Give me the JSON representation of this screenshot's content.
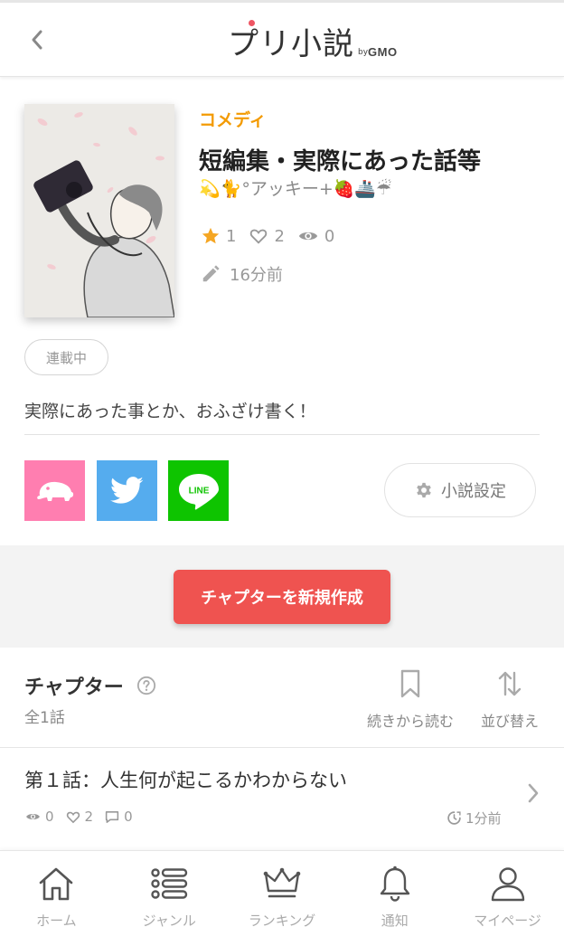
{
  "header": {
    "logo_text": "プリ小説",
    "logo_by": "by",
    "logo_gmo": "GMO"
  },
  "novel": {
    "genre": "コメディ",
    "title": "短編集・実際にあった話等",
    "author": "💫🐈°アッキー+🍓🚢☔",
    "stars": "1",
    "likes": "2",
    "views": "0",
    "updated": "16分前",
    "status": "連載中",
    "description": "実際にあった事とか、おふざけ書く！"
  },
  "share": {
    "line_label": "LINE"
  },
  "settings_label": "小説設定",
  "create_chapter_label": "チャプターを新規作成",
  "chapters": {
    "heading": "チャプター",
    "count": "全1話",
    "continue_label": "続きから読む",
    "sort_label": "並び替え",
    "items": [
      {
        "title": "第１話：人生何が起こるかわからない",
        "views": "0",
        "likes": "2",
        "comments": "0",
        "time": "1分前"
      }
    ]
  },
  "bottom_nav": [
    {
      "label": "ホーム",
      "icon": "home-icon"
    },
    {
      "label": "ジャンル",
      "icon": "list-icon"
    },
    {
      "label": "ランキング",
      "icon": "crown-icon"
    },
    {
      "label": "通知",
      "icon": "bell-icon"
    },
    {
      "label": "マイページ",
      "icon": "user-icon"
    }
  ],
  "colors": {
    "genre": "#f39a00",
    "create_button": "#ef5350",
    "prcm_share": "#ff7eb0",
    "twitter_share": "#55acee",
    "line_share": "#0ec400",
    "star": "#f5a623"
  }
}
